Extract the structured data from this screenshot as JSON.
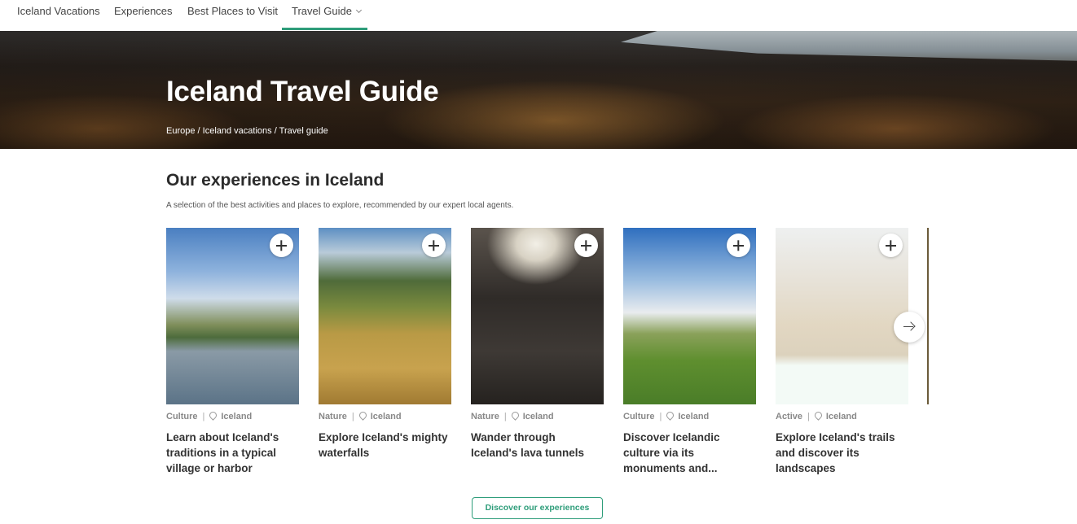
{
  "nav": {
    "items": [
      {
        "label": "Iceland Vacations"
      },
      {
        "label": "Experiences"
      },
      {
        "label": "Best Places to Visit"
      },
      {
        "label": "Travel Guide"
      }
    ]
  },
  "hero": {
    "title": "Iceland Travel Guide",
    "breadcrumb": [
      "Europe",
      "Iceland vacations",
      "Travel guide"
    ],
    "breadcrumb_separator": " / "
  },
  "section": {
    "title": "Our experiences in Iceland",
    "subtitle": "A selection of the best activities and places to explore, recommended by our expert local agents."
  },
  "cards": [
    {
      "category": "Culture",
      "location": "Iceland",
      "title": "Learn about Iceland's traditions in a typical village or harbor"
    },
    {
      "category": "Nature",
      "location": "Iceland",
      "title": "Explore Iceland's mighty waterfalls"
    },
    {
      "category": "Nature",
      "location": "Iceland",
      "title": "Wander through Iceland's lava tunnels"
    },
    {
      "category": "Culture",
      "location": "Iceland",
      "title": "Discover Icelandic culture via its monuments and..."
    },
    {
      "category": "Active",
      "location": "Iceland",
      "title": "Explore Iceland's trails and discover its landscapes"
    }
  ],
  "meta_separator": "|",
  "cta": {
    "label": "Discover our experiences"
  },
  "colors": {
    "accent": "#2e9d7a"
  }
}
